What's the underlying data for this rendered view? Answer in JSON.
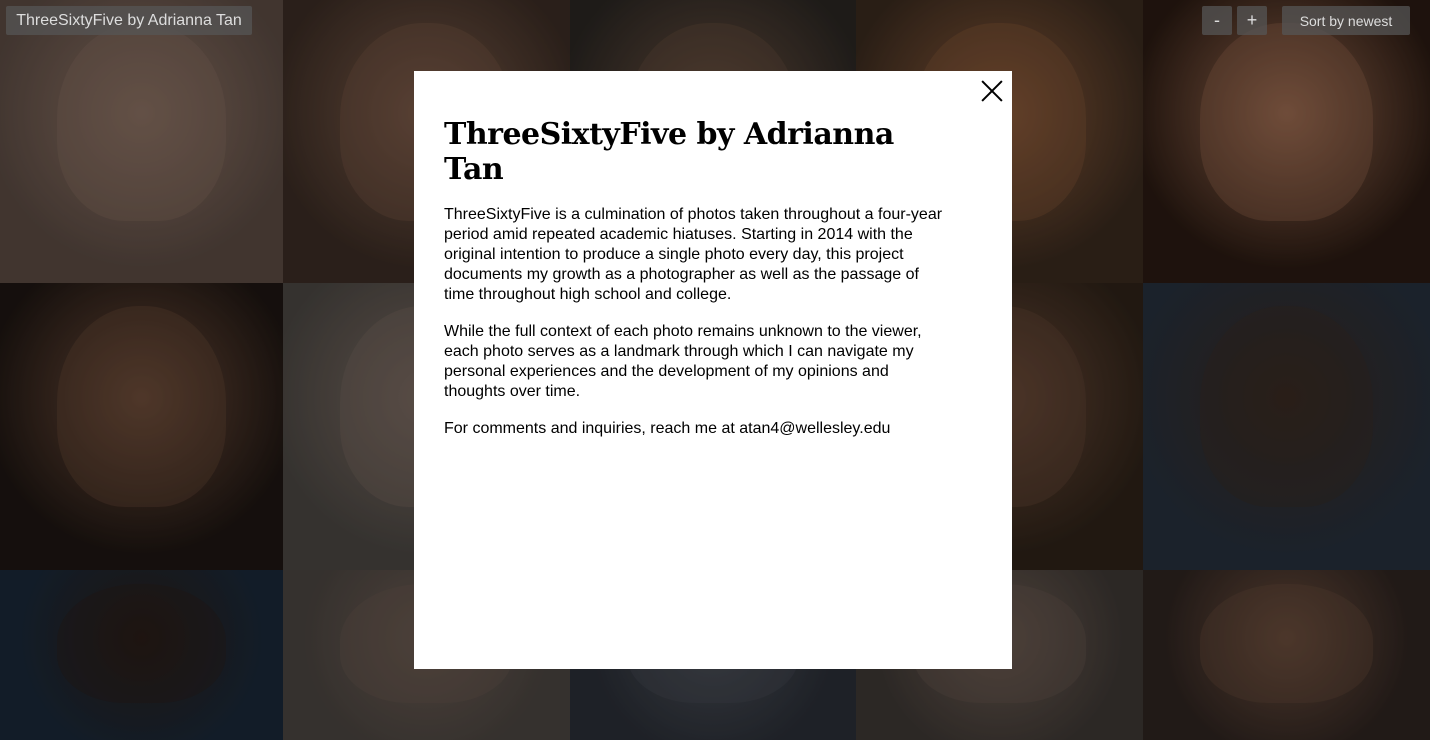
{
  "header": {
    "site_title": "ThreeSixtyFive by Adrianna Tan",
    "zoom_out_label": "-",
    "zoom_in_label": "+",
    "sort_label": "Sort by newest"
  },
  "modal": {
    "title": "ThreeSixtyFive by Adrianna Tan",
    "paragraphs": [
      "ThreeSixtyFive is a culmination of photos taken throughout a four-year period amid repeated academic hiatuses. Starting in 2014 with the original intention to produce a single photo every day, this project documents my growth as a photographer as well as the passage of time throughout high school and college.",
      "While the full context of each photo remains unknown to the viewer, each photo serves as a landmark through which I can navigate my personal experiences and the development of my opinions and thoughts over time.",
      "For comments and inquiries, reach me at atan4@wellesley.edu"
    ],
    "close_icon": "close-icon"
  },
  "photo_tiles": [
    {
      "bg": "#5a4a42",
      "tone": "#8a7062"
    },
    {
      "bg": "#3b2c24",
      "tone": "#7a5a48"
    },
    {
      "bg": "#2a2622",
      "tone": "#6a5040"
    },
    {
      "bg": "#3a2a1e",
      "tone": "#8a5a3a"
    },
    {
      "bg": "#2a1a12",
      "tone": "#9a6a50"
    },
    {
      "bg": "#1e1612",
      "tone": "#6e4c3a"
    },
    {
      "bg": "#4a4642",
      "tone": "#7a6a60"
    },
    {
      "bg": "#3a3632",
      "tone": "#5a4a40"
    },
    {
      "bg": "#2e2218",
      "tone": "#6a4a38"
    },
    {
      "bg": "#26303c",
      "tone": "#3a2a22"
    },
    {
      "bg": "#1a2838",
      "tone": "#2a1e18"
    },
    {
      "bg": "#4a4440",
      "tone": "#6a5a50"
    },
    {
      "bg": "#2a2e36",
      "tone": "#4a4e56"
    },
    {
      "bg": "#3e3834",
      "tone": "#6a5a50"
    },
    {
      "bg": "#2e2420",
      "tone": "#6a4c3c"
    }
  ]
}
